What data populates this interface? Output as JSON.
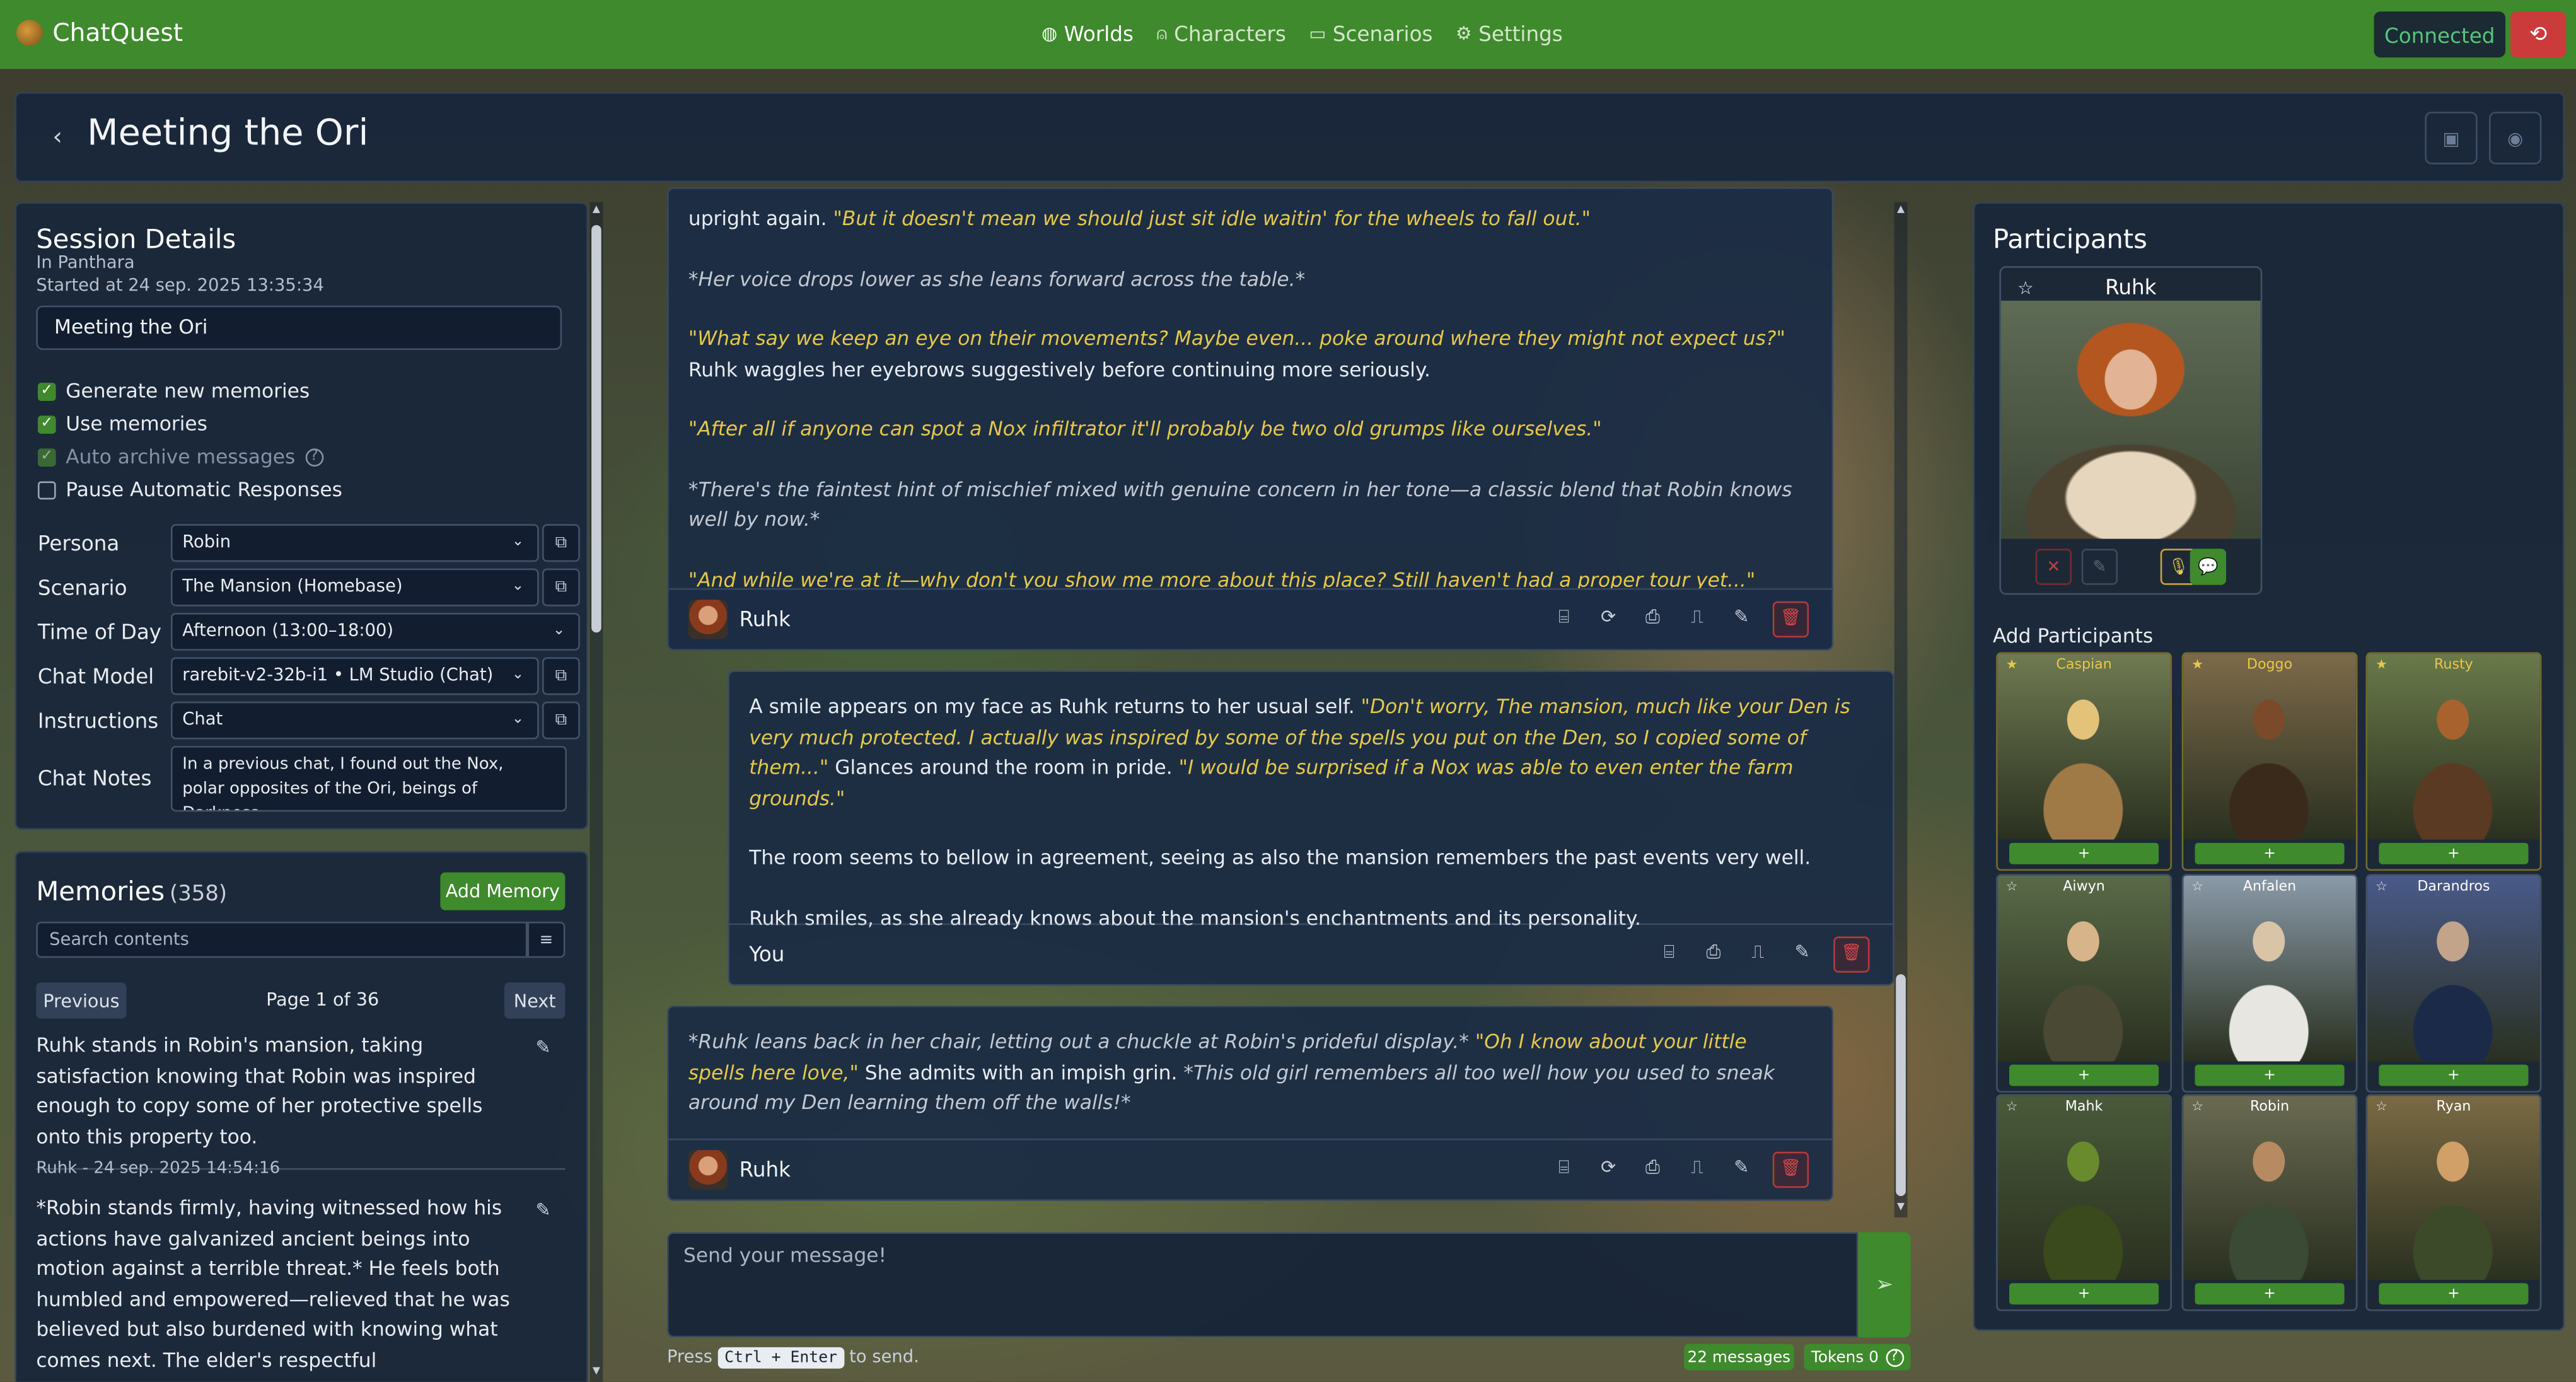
{
  "app": {
    "name": "ChatQuest"
  },
  "nav": [
    {
      "label": "Worlds",
      "icon": "globe-icon"
    },
    {
      "label": "Characters",
      "icon": "person-icon"
    },
    {
      "label": "Scenarios",
      "icon": "book-icon"
    },
    {
      "label": "Settings",
      "icon": "gear-icon"
    }
  ],
  "status": {
    "connection": "Connected"
  },
  "page": {
    "title": "Meeting the Ori"
  },
  "session": {
    "title": "Session Details",
    "world": "In Panthara",
    "started": "Started at 24 sep. 2025 13:35:34",
    "name_value": "Meeting the Ori",
    "checks": [
      {
        "label": "Generate new memories",
        "checked": true,
        "disabled": false
      },
      {
        "label": "Use memories",
        "checked": true,
        "disabled": false
      },
      {
        "label": "Auto archive messages",
        "checked": true,
        "disabled": true
      },
      {
        "label": "Pause Automatic Responses",
        "checked": false,
        "disabled": false
      }
    ],
    "fields": {
      "persona": {
        "label": "Persona",
        "value": "Robin"
      },
      "scenario": {
        "label": "Scenario",
        "value": "The Mansion (Homebase)"
      },
      "time_of_day": {
        "label": "Time of Day",
        "value": "Afternoon (13:00–18:00)"
      },
      "chat_model": {
        "label": "Chat Model",
        "value": "rarebit-v2-32b-i1 • LM Studio (Chat)"
      },
      "instructions": {
        "label": "Instructions",
        "value": "Chat"
      },
      "chat_notes": {
        "label": "Chat Notes",
        "value": "In a previous chat, I found out the Nox, polar opposites of the Ori, beings of Darkness,"
      }
    }
  },
  "memories": {
    "title": "Memories",
    "count": "(358)",
    "add_label": "Add Memory",
    "search_placeholder": "Search contents",
    "prev_label": "Previous",
    "next_label": "Next",
    "page_text": "Page 1 of 36",
    "items": [
      {
        "text": "Ruhk stands in Robin's mansion, taking satisfaction knowing that Robin was inspired enough to copy some of her protective spells onto this property too.",
        "meta": "Ruhk - 24 sep. 2025 14:54:16"
      },
      {
        "text": "*Robin stands firmly, having witnessed how his actions have galvanized ancient beings into motion against a terrible threat.* He feels both humbled and empowered—relieved that he was believed but also burdened with knowing what comes next. The elder's respectful acknowledgment of him has given Robin"
      }
    ]
  },
  "chat": {
    "messages": [
      {
        "author": "Ruhk",
        "lines": [
          [
            {
              "t": "upright again. ",
              "s": ""
            },
            {
              "t": "\"But it doesn't mean we should just sit idle waitin' for the wheels to fall out.\"",
              "s": "q"
            }
          ],
          [
            {
              "t": "*Her voice drops lower as she leans forward across the table.*",
              "s": "act"
            }
          ],
          [
            {
              "t": "\"What say we keep an eye on their movements? Maybe even... poke around where they might not expect us?\"",
              "s": "q"
            },
            {
              "t": " Ruhk waggles her eyebrows suggestively before continuing more seriously.",
              "s": ""
            }
          ],
          [
            {
              "t": "\"After all if anyone can spot a Nox infiltrator it'll probably be two old grumps like ourselves.\"",
              "s": "q"
            }
          ],
          [
            {
              "t": "*There's the faintest hint of mischief mixed with genuine concern in her tone—a classic blend that Robin knows well by now.*",
              "s": "act"
            }
          ],
          [
            {
              "t": "\"And while we're at it—why don't you show me more about this place? Still haven't had a proper tour yet...\"",
              "s": "q"
            }
          ]
        ]
      },
      {
        "author": "You",
        "lines": [
          [
            {
              "t": "A smile appears on my face as Ruhk returns to her usual self. ",
              "s": ""
            },
            {
              "t": "\"Don't worry, The mansion, much like your Den is very much protected. I actually was inspired by some of the spells you put on the Den, so I copied some of them...\"",
              "s": "q"
            },
            {
              "t": " Glances around the room in pride. ",
              "s": ""
            },
            {
              "t": "\"I would be surprised if a Nox was able to even enter the farm grounds.\"",
              "s": "q"
            }
          ],
          [
            {
              "t": "The room seems to bellow in agreement, seeing as also the mansion remembers the past events very well.",
              "s": ""
            }
          ],
          [
            {
              "t": "Rukh smiles, as she already knows about the mansion's enchantments and its personality.",
              "s": ""
            }
          ]
        ]
      },
      {
        "author": "Ruhk",
        "lines": [
          [
            {
              "t": "*Ruhk leans back in her chair, letting out a chuckle at Robin's prideful display.*",
              "s": "act"
            },
            {
              "t": " \"Oh I know about your little spells here love,\"",
              "s": "q"
            },
            {
              "t": " She admits with an impish grin. ",
              "s": ""
            },
            {
              "t": "*This old girl remembers all too well how you used to sneak around my Den learning them off the walls!*",
              "s": "act"
            }
          ]
        ]
      }
    ],
    "input_placeholder": "Send your message!",
    "hint_prefix": "Press",
    "hint_key": "Ctrl + Enter",
    "hint_suffix": "to send.",
    "messages_badge": "22 messages",
    "tokens_badge": "Tokens 0"
  },
  "participants": {
    "title": "Participants",
    "active": {
      "name": "Ruhk"
    },
    "add_title": "Add Participants",
    "add_button": "+",
    "characters": [
      {
        "name": "Caspian",
        "favorite": true
      },
      {
        "name": "Doggo",
        "favorite": true
      },
      {
        "name": "Rusty",
        "favorite": true
      },
      {
        "name": "Aiwyn",
        "favorite": false
      },
      {
        "name": "Anfalen",
        "favorite": false
      },
      {
        "name": "Darandros",
        "favorite": false
      },
      {
        "name": "Mahk",
        "favorite": false
      },
      {
        "name": "Robin",
        "favorite": false
      },
      {
        "name": "Ryan",
        "favorite": false
      }
    ]
  },
  "colors": {
    "accent": "#3e8a2c",
    "danger": "#cc3b3b",
    "quote": "#e6c84a",
    "panel": "#18263a"
  }
}
